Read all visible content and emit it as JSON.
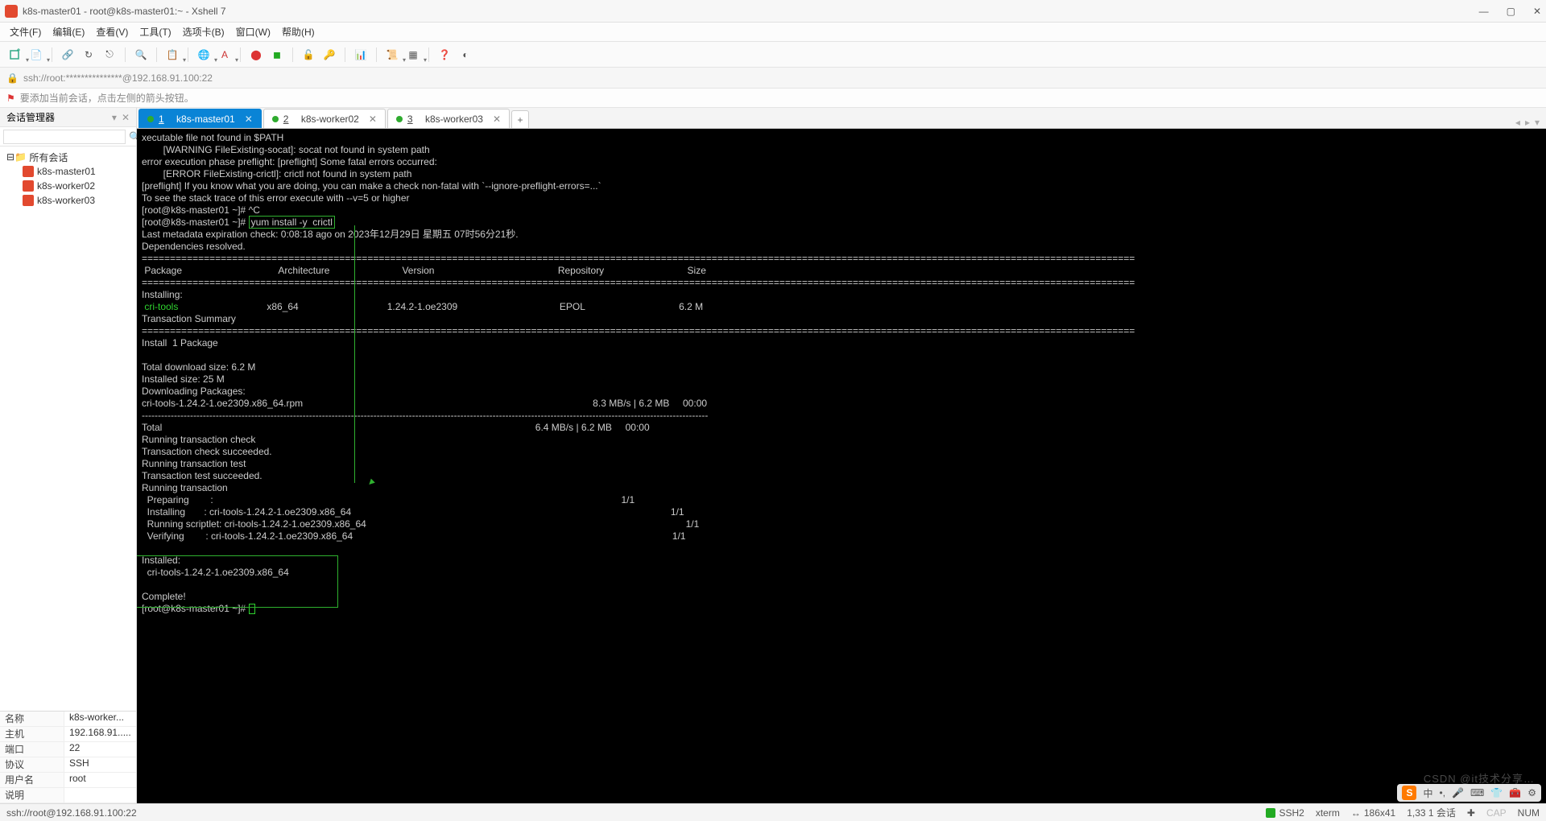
{
  "title": "k8s-master01 - root@k8s-master01:~ - Xshell 7",
  "menu": [
    "文件(F)",
    "编辑(E)",
    "查看(V)",
    "工具(T)",
    "选项卡(B)",
    "窗口(W)",
    "帮助(H)"
  ],
  "address": "ssh://root:***************@192.168.91.100:22",
  "hint": "要添加当前会话，点击左侧的箭头按钮。",
  "sidebar_title": "会话管理器",
  "search_placeholder": "",
  "tree": {
    "root": "所有会话",
    "hosts": [
      "k8s-master01",
      "k8s-worker02",
      "k8s-worker03"
    ]
  },
  "props": [
    {
      "k": "名称",
      "v": "k8s-worker..."
    },
    {
      "k": "主机",
      "v": "192.168.91....."
    },
    {
      "k": "端口",
      "v": "22"
    },
    {
      "k": "协议",
      "v": "SSH"
    },
    {
      "k": "用户名",
      "v": "root"
    },
    {
      "k": "说明",
      "v": ""
    }
  ],
  "tabs": [
    {
      "n": "1",
      "label": "k8s-master01",
      "active": true
    },
    {
      "n": "2",
      "label": "k8s-worker02",
      "active": false
    },
    {
      "n": "3",
      "label": "k8s-worker03",
      "active": false
    }
  ],
  "term": {
    "pre1": "xecutable file not found in $PATH\n        [WARNING FileExisting-socat]: socat not found in system path\nerror execution phase preflight: [preflight] Some fatal errors occurred:\n        [ERROR FileExisting-crictl]: crictl not found in system path\n[preflight] If you know what you are doing, you can make a check non-fatal with `--ignore-preflight-errors=...`\nTo see the stack trace of this error execute with --v=5 or higher\n[root@k8s-master01 ~]# ^C\n[root@k8s-master01 ~]# ",
    "cmd": "yum install -y  crictl",
    "pre2": "\nLast metadata expiration check: 0:08:18 ago on 2023年12月29日 星期五 07时56分21秒.\nDependencies resolved.\n",
    "hdr": " Package                                    Architecture                           Version                                              Repository                               Size",
    "pkg_name": " cri-tools",
    "pkg_row_rest": "                                 x86_64                                 1.24.2-1.oe2309                                      EPOL                                   6.2 M",
    "mid": "\nTransaction Summary\n",
    "mid2": "Install  1 Package\n\nTotal download size: 6.2 M\nInstalled size: 25 M\nDownloading Packages:\ncri-tools-1.24.2-1.oe2309.x86_64.rpm                                                                                                            8.3 MB/s | 6.2 MB     00:00\n",
    "tot": "Total                                                                                                                                           6.4 MB/s | 6.2 MB     00:00\nRunning transaction check\nTransaction check succeeded.\nRunning transaction test\nTransaction test succeeded.\nRunning transaction\n  Preparing        :                                                                                                                                                        1/1\n  Installing       : cri-tools-1.24.2-1.oe2309.x86_64                                                                                                                       1/1\n  Running scriptlet: cri-tools-1.24.2-1.oe2309.x86_64                                                                                                                       1/1\n  Verifying        : cri-tools-1.24.2-1.oe2309.x86_64                                                                                                                       1/1\n\nInstalled:\n  cri-tools-1.24.2-1.oe2309.x86_64\n\nComplete!",
    "prompt": "[root@k8s-master01 ~]# ",
    "installing_label": "Installing:"
  },
  "status": {
    "left": "ssh://root@192.168.91.100:22",
    "ssh": "SSH2",
    "term": "xterm",
    "size": "186x41",
    "rc": "1,33  1 会话",
    "caps": "CAP",
    "num": "NUM"
  },
  "watermark": "CSDN @it技术分享…",
  "ime_label": "中"
}
